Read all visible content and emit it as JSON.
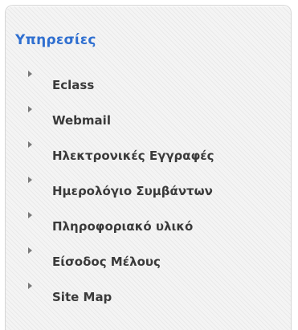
{
  "panel": {
    "title": "Υπηρεσίες",
    "items": [
      {
        "label": "Eclass"
      },
      {
        "label": "Webmail"
      },
      {
        "label": "Ηλεκτρονικές Εγγραφές"
      },
      {
        "label": "Ημερολόγιο Συμβάντων"
      },
      {
        "label": "Πληροφοριακό υλικό"
      },
      {
        "label": "Είσοδος Μέλους"
      },
      {
        "label": "Site Map"
      }
    ]
  },
  "colors": {
    "title": "#2f6fd0",
    "item_text": "#3a3a3a",
    "bullet": "#7a7a7a"
  },
  "icons": {
    "bullet": "triangle-right-icon"
  }
}
